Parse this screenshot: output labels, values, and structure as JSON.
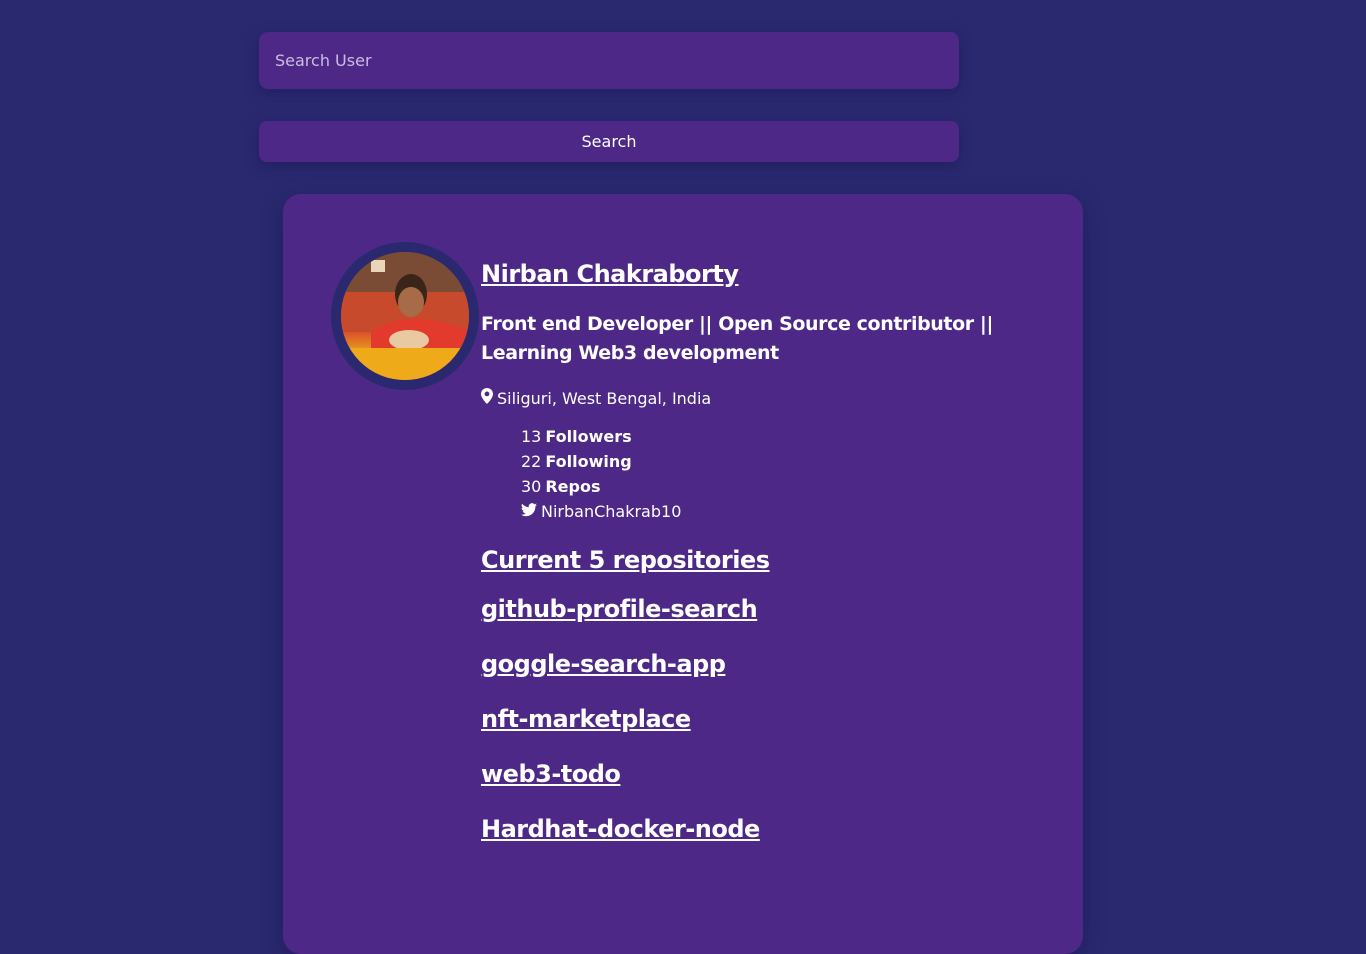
{
  "search": {
    "placeholder": "Search User",
    "value": "",
    "button_label": "Search"
  },
  "profile": {
    "name": "Nirban Chakraborty",
    "bio": "Front end Developer || Open Source contributor || Learning Web3 development",
    "location": "Siliguri, West Bengal, India",
    "followers_count": "13",
    "followers_label": "Followers",
    "following_count": "22",
    "following_label": "Following",
    "repos_count": "30",
    "repos_label": "Repos",
    "twitter": "NirbanChakrab10",
    "location_icon": "map-pin-icon",
    "twitter_icon": "twitter-icon"
  },
  "repos": {
    "title": "Current 5 repositories",
    "items": [
      "github-profile-search",
      "goggle-search-app",
      "nft-marketplace",
      "web3-todo",
      "Hardhat-docker-node"
    ]
  },
  "colors": {
    "background": "#2a2970",
    "card": "#4d2886",
    "text": "#ffffff"
  }
}
